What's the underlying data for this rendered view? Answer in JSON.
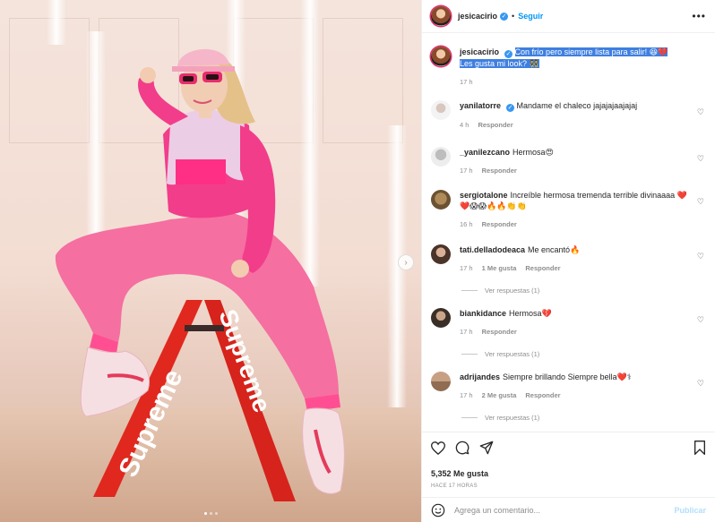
{
  "post": {
    "username": "jesicacirio",
    "follow_label": "Seguir",
    "caption_line1": "Con frío pero siempre lista para salir! 😆💔",
    "caption_line2": "Les gusta mi look? 👯",
    "caption_time": "17 h"
  },
  "comments": [
    {
      "user": "yanilatorre",
      "verified": true,
      "text": "Mandame el chaleco jajajajaajajaj",
      "time": "4 h",
      "likes": "",
      "reply": "Responder",
      "view_replies": ""
    },
    {
      "user": "_yanilezcano",
      "verified": false,
      "text": "Hermosa😍",
      "time": "17 h",
      "likes": "",
      "reply": "Responder",
      "view_replies": ""
    },
    {
      "user": "sergiotalone",
      "verified": false,
      "text": "Increíble hermosa tremenda terrible divinaaaa ❤️ ❤️😱😱🔥🔥👏👏",
      "time": "16 h",
      "likes": "",
      "reply": "Responder",
      "view_replies": ""
    },
    {
      "user": "tati.delladodeaca",
      "verified": false,
      "text": "Me encantó🔥",
      "time": "17 h",
      "likes": "1 Me gusta",
      "reply": "Responder",
      "view_replies": "Ver respuestas (1)"
    },
    {
      "user": "biankidance",
      "verified": false,
      "text": "Hermosa💔",
      "time": "17 h",
      "likes": "",
      "reply": "Responder",
      "view_replies": "Ver respuestas (1)"
    },
    {
      "user": "adrijandes",
      "verified": false,
      "text": "Siempre brillando Siempre bella❤️⚕",
      "time": "17 h",
      "likes": "2 Me gusta",
      "reply": "Responder",
      "view_replies": "Ver respuestas (1)"
    }
  ],
  "actions": {
    "likes": "5,352 Me gusta",
    "time_ago": "HACE 17 HORAS"
  },
  "add_comment": {
    "placeholder": "Agrega un comentario...",
    "publish_label": "Publicar"
  },
  "icons": {
    "like": "heart-icon",
    "comment": "comment-icon",
    "share": "share-icon",
    "save": "bookmark-icon",
    "emoji": "emoji-icon",
    "more": "more-options-icon",
    "verified": "verified-badge-icon",
    "next": "next-arrow-icon"
  },
  "colors": {
    "accent": "#0095f6",
    "caption_highlight": "#3f7fe0",
    "jacket_pink": "#f23d8b",
    "pants_pink": "#f56fa1",
    "stool_red": "#e0281f"
  },
  "carousel": {
    "count": 3,
    "active": 1
  }
}
